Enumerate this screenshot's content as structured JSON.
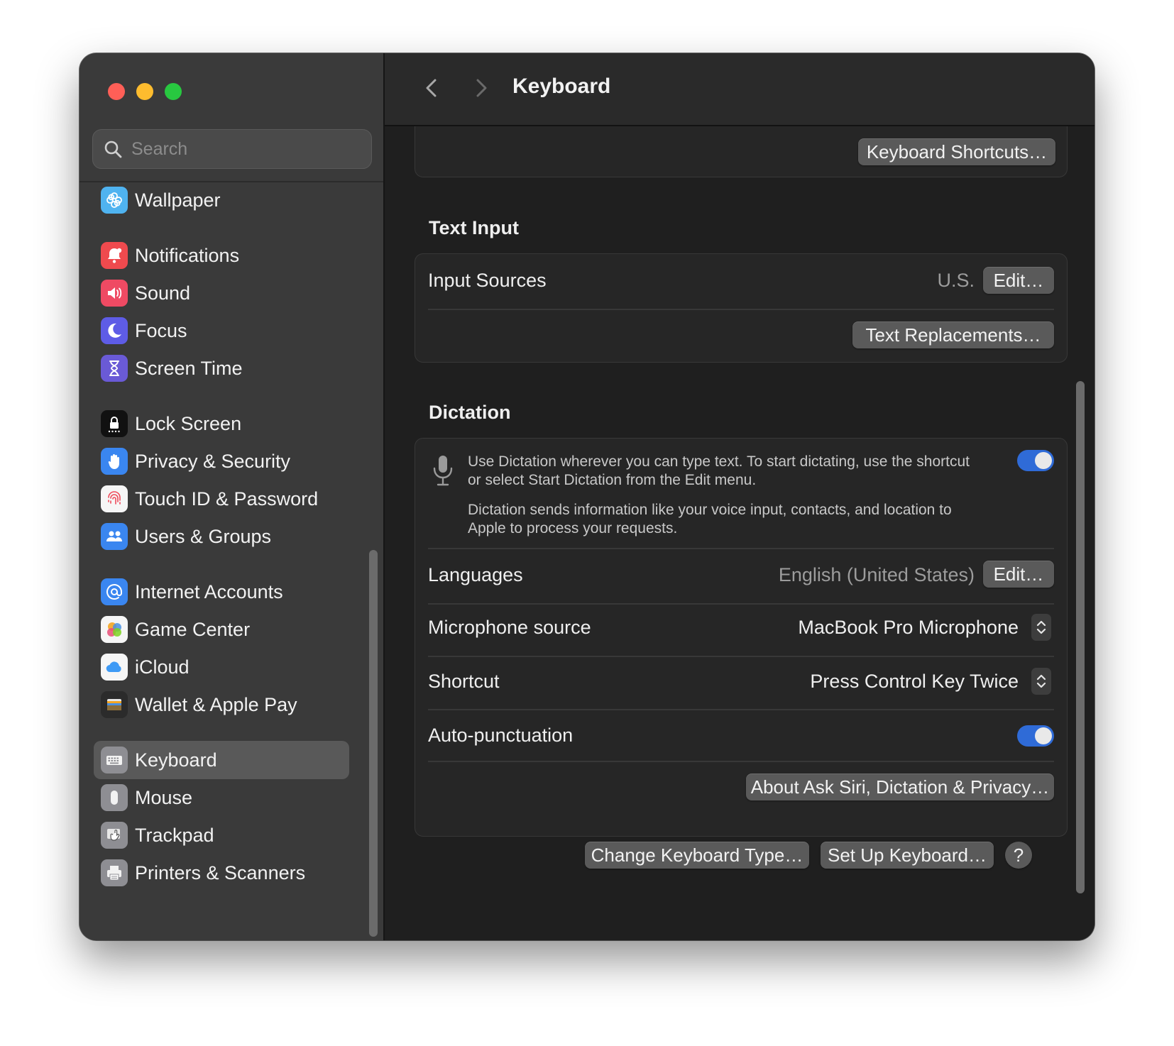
{
  "window": {
    "title": "Keyboard"
  },
  "search": {
    "placeholder": "Search",
    "value": ""
  },
  "sidebar": {
    "items": [
      {
        "label": "Wallpaper",
        "icon": "wallpaper-icon",
        "color": "#4fb3f0"
      },
      {
        "label": "Notifications",
        "icon": "bell-icon",
        "color": "#ef4a4e"
      },
      {
        "label": "Sound",
        "icon": "speaker-icon",
        "color": "#ef4a63"
      },
      {
        "label": "Focus",
        "icon": "moon-icon",
        "color": "#5e5ce6"
      },
      {
        "label": "Screen Time",
        "icon": "hourglass-icon",
        "color": "#6a5ad6"
      },
      {
        "label": "Lock Screen",
        "icon": "lock-icon",
        "color": "#111111"
      },
      {
        "label": "Privacy & Security",
        "icon": "hand-icon",
        "color": "#3a86f0"
      },
      {
        "label": "Touch ID & Password",
        "icon": "fingerprint-icon",
        "color": "#f6f6f6"
      },
      {
        "label": "Users & Groups",
        "icon": "users-icon",
        "color": "#3a86f0"
      },
      {
        "label": "Internet Accounts",
        "icon": "at-icon",
        "color": "#3a86f0"
      },
      {
        "label": "Game Center",
        "icon": "game-center-icon",
        "color": "#f6f6f6"
      },
      {
        "label": "iCloud",
        "icon": "cloud-icon",
        "color": "#f6f6f6"
      },
      {
        "label": "Wallet & Apple Pay",
        "icon": "wallet-icon",
        "color": "#2b2b2b"
      },
      {
        "label": "Keyboard",
        "icon": "keyboard-icon",
        "color": "#8e8e93",
        "selected": true
      },
      {
        "label": "Mouse",
        "icon": "mouse-icon",
        "color": "#8e8e93"
      },
      {
        "label": "Trackpad",
        "icon": "trackpad-icon",
        "color": "#8e8e93"
      },
      {
        "label": "Printers & Scanners",
        "icon": "printer-icon",
        "color": "#8e8e93"
      }
    ]
  },
  "top_card": {
    "keyboard_shortcuts_label": "Keyboard Shortcuts…"
  },
  "text_input": {
    "title": "Text Input",
    "input_sources_label": "Input Sources",
    "input_sources_value": "U.S.",
    "edit_label": "Edit…",
    "text_replacements_label": "Text Replacements…"
  },
  "dictation": {
    "title": "Dictation",
    "description": "Use Dictation wherever you can type text. To start dictating, use the shortcut or select Start Dictation from the Edit menu.",
    "privacy_note": "Dictation sends information like your voice input, contacts, and location to Apple to process your requests.",
    "enabled": true,
    "languages_label": "Languages",
    "languages_value": "English (United States)",
    "languages_edit_label": "Edit…",
    "microphone_label": "Microphone source",
    "microphone_value": "MacBook Pro Microphone",
    "shortcut_label": "Shortcut",
    "shortcut_value": "Press Control Key Twice",
    "auto_punctuation_label": "Auto-punctuation",
    "auto_punctuation_enabled": true,
    "about_label": "About Ask Siri, Dictation & Privacy…"
  },
  "footer": {
    "change_keyboard_label": "Change Keyboard Type…",
    "setup_keyboard_label": "Set Up Keyboard…",
    "help_label": "?"
  },
  "colors": {
    "accent": "#2f6bd7",
    "close": "#ff5f57",
    "minimize": "#febc2e",
    "maximize": "#28c840"
  }
}
